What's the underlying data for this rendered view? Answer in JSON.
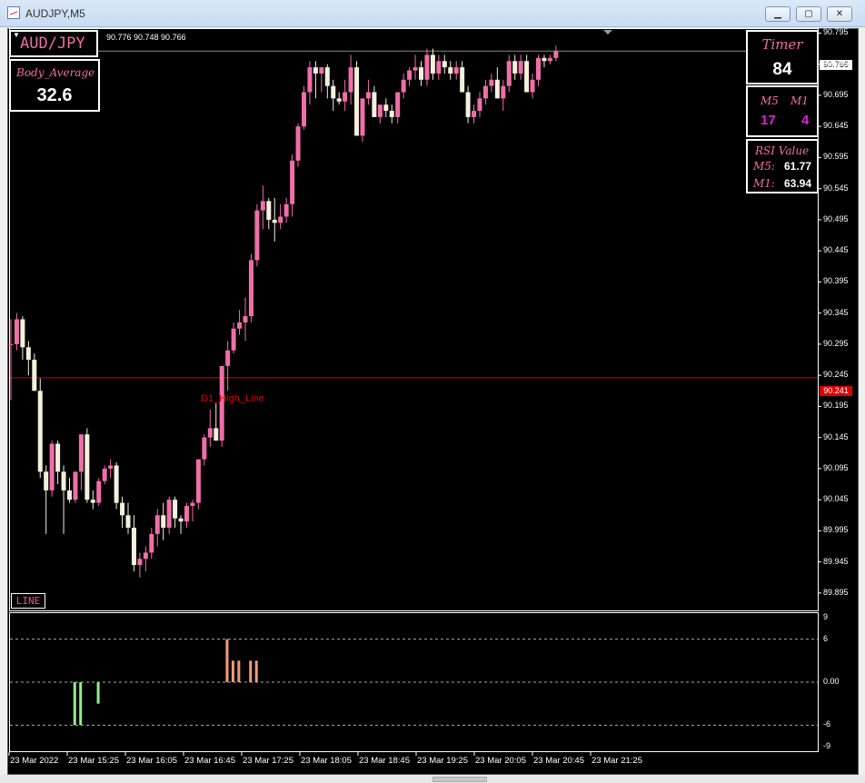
{
  "window": {
    "title": "AUDJPY,M5"
  },
  "ohlc_text": "90.776 90.748 90.766",
  "symbol_box": {
    "label": "AUD/JPY"
  },
  "body_average": {
    "label": "Body_Average",
    "value": "32.6"
  },
  "timer": {
    "label": "Timer",
    "value": "84"
  },
  "timeframes": {
    "m5_label": "M5",
    "m1_label": "M1",
    "m5_value": "17",
    "m1_value": "4"
  },
  "rsi": {
    "title": "RSI Value",
    "m5_label": "M5:",
    "m5_value": "61.77",
    "m1_label": "M1:",
    "m1_value": "63.94"
  },
  "line_button": "LINE",
  "d1_line": {
    "label": "D1_High_Line",
    "price": "90.241"
  },
  "current_price": "90.766",
  "colors": {
    "bull": "#f06ea9",
    "bear": "#f5f0dc",
    "d1_line": "#dd0000",
    "hist_up": "#f29b7a",
    "hist_down": "#90ee90"
  },
  "chart_data": [
    {
      "type": "candlestick",
      "title": "AUDJPY,M5",
      "ylim": [
        89.87,
        90.8
      ],
      "price_ticks": [
        "90.795",
        "90.745",
        "90.695",
        "90.645",
        "90.595",
        "90.545",
        "90.495",
        "90.445",
        "90.395",
        "90.345",
        "90.295",
        "90.245",
        "90.195",
        "90.145",
        "90.095",
        "90.045",
        "89.995",
        "89.945",
        "89.895"
      ],
      "time_ticks": [
        "23 Mar 2022",
        "23 Mar 15:25",
        "23 Mar 16:05",
        "23 Mar 16:45",
        "23 Mar 17:25",
        "23 Mar 18:05",
        "23 Mar 18:45",
        "23 Mar 19:25",
        "23 Mar 20:05",
        "23 Mar 20:45",
        "23 Mar 21:25"
      ],
      "candles": [
        [
          90.295,
          90.335,
          90.205,
          90.295
        ],
        [
          90.295,
          90.345,
          90.285,
          90.335
        ],
        [
          90.335,
          90.34,
          90.27,
          90.29
        ],
        [
          90.29,
          90.3,
          90.245,
          90.27
        ],
        [
          90.27,
          90.28,
          90.22,
          90.22
        ],
        [
          90.22,
          90.24,
          90.08,
          90.09
        ],
        [
          90.09,
          90.1,
          89.99,
          90.06
        ],
        [
          90.06,
          90.14,
          90.05,
          90.135
        ],
        [
          90.135,
          90.14,
          90.07,
          90.09
        ],
        [
          90.09,
          90.1,
          89.99,
          90.06
        ],
        [
          90.06,
          90.08,
          90.04,
          90.045
        ],
        [
          90.045,
          90.09,
          90.04,
          90.09
        ],
        [
          90.09,
          90.15,
          90.06,
          90.15
        ],
        [
          90.15,
          90.16,
          90.04,
          90.045
        ],
        [
          90.045,
          90.06,
          90.03,
          90.04
        ],
        [
          90.04,
          90.08,
          90.035,
          90.075
        ],
        [
          90.075,
          90.1,
          90.07,
          90.095
        ],
        [
          90.095,
          90.11,
          90.08,
          90.1
        ],
        [
          90.1,
          90.105,
          90.03,
          90.04
        ],
        [
          90.04,
          90.05,
          90.0,
          90.02
        ],
        [
          90.02,
          90.04,
          89.99,
          90.0
        ],
        [
          90.0,
          90.02,
          89.93,
          89.94
        ],
        [
          89.94,
          89.96,
          89.92,
          89.95
        ],
        [
          89.95,
          89.97,
          89.93,
          89.96
        ],
        [
          89.96,
          90.0,
          89.95,
          89.99
        ],
        [
          89.99,
          90.03,
          89.97,
          90.02
        ],
        [
          90.02,
          90.04,
          89.98,
          90.0
        ],
        [
          90.0,
          90.05,
          89.99,
          90.045
        ],
        [
          90.045,
          90.05,
          90.0,
          90.015
        ],
        [
          90.015,
          90.02,
          89.99,
          90.01
        ],
        [
          90.01,
          90.04,
          90.0,
          90.035
        ],
        [
          90.035,
          90.045,
          90.01,
          90.04
        ],
        [
          90.04,
          90.11,
          90.03,
          90.11
        ],
        [
          90.11,
          90.15,
          90.1,
          90.145
        ],
        [
          90.145,
          90.19,
          90.13,
          90.16
        ],
        [
          90.16,
          90.2,
          90.14,
          90.14
        ],
        [
          90.14,
          90.26,
          90.13,
          90.26
        ],
        [
          90.26,
          90.3,
          90.22,
          90.285
        ],
        [
          90.285,
          90.33,
          90.28,
          90.32
        ],
        [
          90.32,
          90.35,
          90.31,
          90.33
        ],
        [
          90.33,
          90.37,
          90.3,
          90.34
        ],
        [
          90.34,
          90.44,
          90.33,
          90.43
        ],
        [
          90.43,
          90.52,
          90.42,
          90.51
        ],
        [
          90.51,
          90.55,
          90.48,
          90.525
        ],
        [
          90.525,
          90.53,
          90.48,
          90.495
        ],
        [
          90.495,
          90.53,
          90.46,
          90.49
        ],
        [
          90.49,
          90.52,
          90.48,
          90.5
        ],
        [
          90.5,
          90.53,
          90.49,
          90.52
        ],
        [
          90.52,
          90.6,
          90.5,
          90.59
        ],
        [
          90.59,
          90.65,
          90.58,
          90.645
        ],
        [
          90.645,
          90.71,
          90.64,
          90.7
        ],
        [
          90.7,
          90.75,
          90.68,
          90.74
        ],
        [
          90.74,
          90.75,
          90.69,
          90.73
        ],
        [
          90.73,
          90.74,
          90.7,
          90.74
        ],
        [
          90.74,
          90.745,
          90.69,
          90.71
        ],
        [
          90.71,
          90.72,
          90.67,
          90.69
        ],
        [
          90.69,
          90.7,
          90.68,
          90.685
        ],
        [
          90.685,
          90.72,
          90.67,
          90.7
        ],
        [
          90.7,
          90.76,
          90.68,
          90.74
        ],
        [
          90.74,
          90.75,
          90.63,
          90.63
        ],
        [
          90.63,
          90.69,
          90.62,
          90.69
        ],
        [
          90.69,
          90.72,
          90.68,
          90.7
        ],
        [
          90.7,
          90.71,
          90.66,
          90.66
        ],
        [
          90.66,
          90.68,
          90.65,
          90.68
        ],
        [
          90.68,
          90.69,
          90.66,
          90.67
        ],
        [
          90.67,
          90.68,
          90.65,
          90.66
        ],
        [
          90.66,
          90.7,
          90.65,
          90.7
        ],
        [
          90.7,
          90.73,
          90.69,
          90.72
        ],
        [
          90.72,
          90.74,
          90.71,
          90.735
        ],
        [
          90.735,
          90.76,
          90.72,
          90.74
        ],
        [
          90.74,
          90.75,
          90.71,
          90.72
        ],
        [
          90.72,
          90.77,
          90.71,
          90.76
        ],
        [
          90.76,
          90.77,
          90.72,
          90.73
        ],
        [
          90.73,
          90.76,
          90.72,
          90.75
        ],
        [
          90.75,
          90.76,
          90.73,
          90.74
        ],
        [
          90.74,
          90.75,
          90.72,
          90.73
        ],
        [
          90.73,
          90.75,
          90.72,
          90.74
        ],
        [
          90.74,
          90.75,
          90.7,
          90.7
        ],
        [
          90.7,
          90.71,
          90.65,
          90.66
        ],
        [
          90.66,
          90.68,
          90.65,
          90.67
        ],
        [
          90.67,
          90.7,
          90.66,
          90.69
        ],
        [
          90.69,
          90.72,
          90.68,
          90.71
        ],
        [
          90.71,
          90.73,
          90.7,
          90.72
        ],
        [
          90.72,
          90.74,
          90.69,
          90.69
        ],
        [
          90.69,
          90.72,
          90.67,
          90.71
        ],
        [
          90.71,
          90.76,
          90.7,
          90.75
        ],
        [
          90.75,
          90.76,
          90.72,
          90.73
        ],
        [
          90.73,
          90.76,
          90.72,
          90.75
        ],
        [
          90.75,
          90.76,
          90.7,
          90.7
        ],
        [
          90.7,
          90.73,
          90.69,
          90.72
        ],
        [
          90.72,
          90.76,
          90.71,
          90.755
        ],
        [
          90.755,
          90.76,
          90.74,
          90.75
        ],
        [
          90.75,
          90.76,
          90.745,
          90.755
        ],
        [
          90.755,
          90.775,
          90.75,
          90.766
        ]
      ]
    },
    {
      "type": "bar",
      "title": "",
      "ylim": [
        -9,
        9
      ],
      "y_ticks": [
        "9",
        "6",
        "0.00",
        "-6",
        "-9"
      ],
      "bars": [
        {
          "index": 5,
          "value": -6
        },
        {
          "index": 6,
          "value": -6
        },
        {
          "index": 9,
          "value": -3
        },
        {
          "index": 31,
          "value": 6
        },
        {
          "index": 32,
          "value": 3
        },
        {
          "index": 33,
          "value": 3
        },
        {
          "index": 35,
          "value": 3
        },
        {
          "index": 36,
          "value": 3
        }
      ]
    }
  ]
}
